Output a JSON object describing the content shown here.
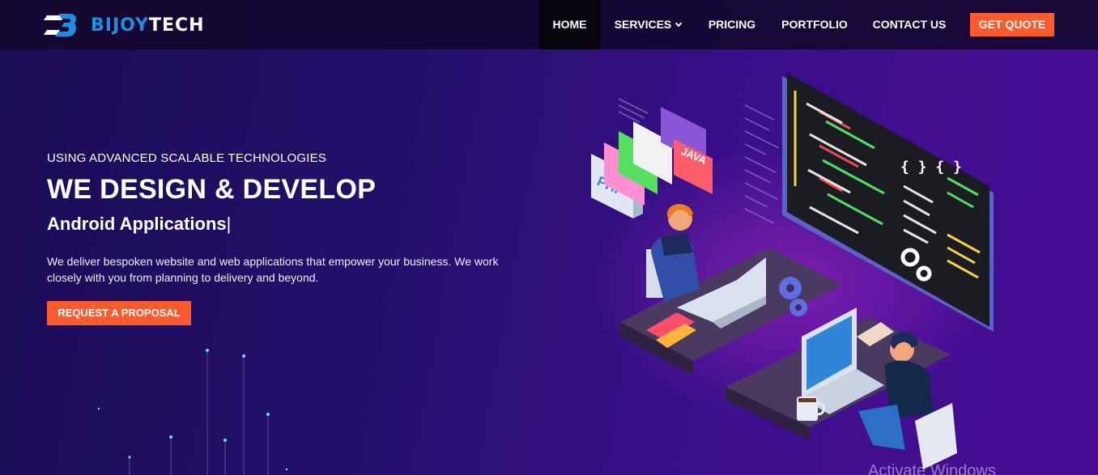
{
  "brand": {
    "name_part1": "BIJOY",
    "name_part2": "TECH"
  },
  "nav": {
    "items": [
      {
        "label": "HOME",
        "active": true
      },
      {
        "label": "SERVICES",
        "has_dropdown": true
      },
      {
        "label": "PRICING"
      },
      {
        "label": "PORTFOLIO"
      },
      {
        "label": "CONTACT US"
      }
    ],
    "cta_label": "GET QUOTE"
  },
  "hero": {
    "eyebrow": "USING ADVANCED SCALABLE TECHNOLOGIES",
    "headline": "WE DESIGN & DEVELOP",
    "typed_text": "Android Applications",
    "cursor": "|",
    "description": "We deliver bespoken website and web applications that empower your business. We work closely with you from planning to delivery and beyond.",
    "button_label": "REQUEST A PROPOSAL"
  },
  "illustration": {
    "book_labels": [
      "PHP",
      "JAVA"
    ],
    "code_braces": "{ } { }"
  },
  "watermark": "Activate Windows",
  "colors": {
    "accent": "#ff5a2c",
    "brand_blue": "#1d8fe0",
    "nav_bg": "#140830",
    "active_nav_bg": "#07030f"
  }
}
